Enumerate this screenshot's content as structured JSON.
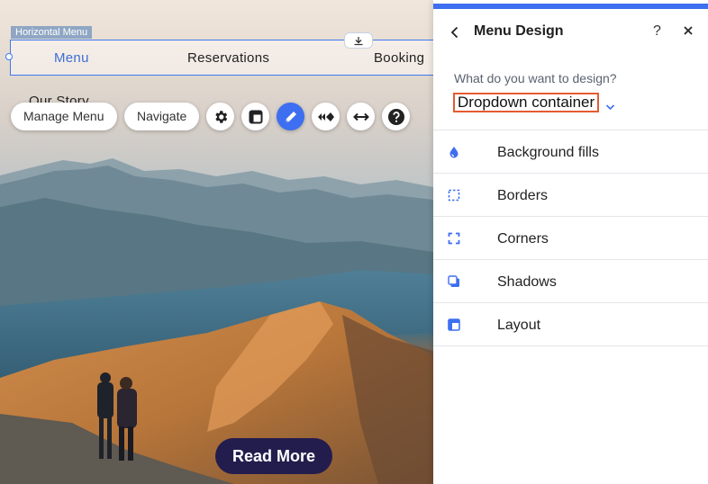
{
  "canvas": {
    "menu_tag": "Horizontal Menu",
    "menu_items": [
      "Menu",
      "Reservations",
      "Booking"
    ],
    "submenu_item": "Our Story",
    "toolbar": {
      "manage_menu": "Manage Menu",
      "navigate": "Navigate",
      "icons": [
        "gear-icon",
        "layout-icon",
        "design-pen-icon",
        "animation-icon",
        "stretch-icon",
        "help-icon"
      ]
    },
    "read_more": "Read More"
  },
  "panel": {
    "title": "Menu Design",
    "help": "?",
    "question": "What do you want to design?",
    "selected_target": "Dropdown container",
    "accent_color": "#3d6ff0",
    "highlight_color": "#e55b32",
    "options": [
      {
        "label": "Background fills",
        "icon": "droplet-icon"
      },
      {
        "label": "Borders",
        "icon": "dashed-square-icon"
      },
      {
        "label": "Corners",
        "icon": "corners-icon"
      },
      {
        "label": "Shadows",
        "icon": "shadow-square-icon"
      },
      {
        "label": "Layout",
        "icon": "layout-icon"
      }
    ]
  }
}
